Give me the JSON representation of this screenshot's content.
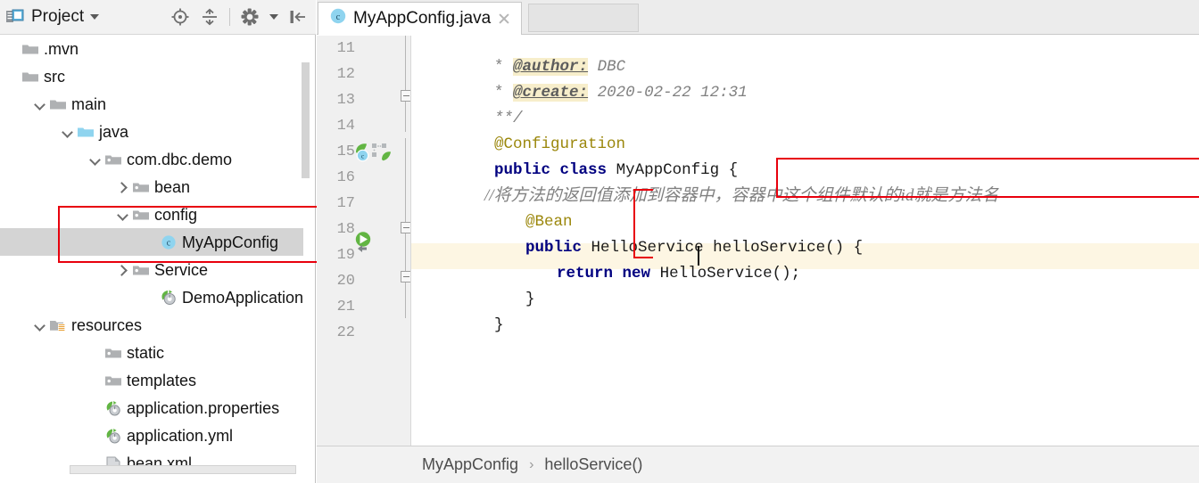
{
  "project_panel": {
    "title": "Project",
    "toolbar_icons": [
      "locate-target-icon",
      "collapse-all-icon",
      "settings-gear-icon",
      "hide-panel-icon"
    ],
    "tree": [
      {
        "label": ".mvn",
        "icon": "folder-grey-icon",
        "indent": 0,
        "arrow": "none",
        "selected": false
      },
      {
        "label": "src",
        "icon": "folder-grey-icon",
        "indent": 0,
        "arrow": "none",
        "selected": false
      },
      {
        "label": "main",
        "icon": "folder-grey-icon",
        "indent": 1,
        "arrow": "down",
        "selected": false
      },
      {
        "label": "java",
        "icon": "folder-blue-icon",
        "indent": 2,
        "arrow": "down",
        "selected": false
      },
      {
        "label": "com.dbc.demo",
        "icon": "package-icon",
        "indent": 3,
        "arrow": "down",
        "selected": false
      },
      {
        "label": "bean",
        "icon": "package-icon",
        "indent": 4,
        "arrow": "right",
        "selected": false
      },
      {
        "label": "config",
        "icon": "package-icon",
        "indent": 4,
        "arrow": "down",
        "selected": false
      },
      {
        "label": "MyAppConfig",
        "icon": "java-class-icon",
        "indent": 5,
        "arrow": "none",
        "selected": true
      },
      {
        "label": "Service",
        "icon": "package-icon",
        "indent": 4,
        "arrow": "right",
        "selected": false
      },
      {
        "label": "DemoApplication",
        "icon": "spring-boot-class-icon",
        "indent": 5,
        "arrow": "none",
        "selected": false
      },
      {
        "label": "resources",
        "icon": "resources-folder-icon",
        "indent": 1,
        "arrow": "down",
        "selected": false
      },
      {
        "label": "static",
        "icon": "package-icon",
        "indent": 3,
        "arrow": "none",
        "selected": false
      },
      {
        "label": "templates",
        "icon": "package-icon",
        "indent": 3,
        "arrow": "none",
        "selected": false
      },
      {
        "label": "application.properties",
        "icon": "spring-file-icon",
        "indent": 3,
        "arrow": "none",
        "selected": false
      },
      {
        "label": "application.yml",
        "icon": "spring-file-icon",
        "indent": 3,
        "arrow": "none",
        "selected": false
      },
      {
        "label": "bean.xml",
        "icon": "xml-file-icon",
        "indent": 3,
        "arrow": "none",
        "selected": false
      }
    ]
  },
  "editor": {
    "tab": {
      "label": "MyAppConfig.java",
      "icon": "java-class-icon",
      "close": "close-icon"
    },
    "first_line_number": 11,
    "lines": [
      {
        "num": 11,
        "gutter_icon": "none"
      },
      {
        "num": 12,
        "gutter_icon": "none"
      },
      {
        "num": 13,
        "gutter_icon": "none"
      },
      {
        "num": 14,
        "gutter_icon": "none"
      },
      {
        "num": 15,
        "gutter_icon": "spring-bean-class-icon"
      },
      {
        "num": 16,
        "gutter_icon": "none"
      },
      {
        "num": 17,
        "gutter_icon": "spring-bean-navigate-icon"
      },
      {
        "num": 18,
        "gutter_icon": "none"
      },
      {
        "num": 19,
        "gutter_icon": "none"
      },
      {
        "num": 20,
        "gutter_icon": "none"
      },
      {
        "num": 21,
        "gutter_icon": "none"
      },
      {
        "num": 22,
        "gutter_icon": "none"
      }
    ],
    "code": {
      "l11_star": "*",
      "l11_tag": "@author:",
      "l11_val": "DBC",
      "l12_star": "*",
      "l12_tag": "@create:",
      "l12_val": "2020-02-22 12:31",
      "l13": "**/",
      "l14": "@Configuration",
      "l15_kw": "public class",
      "l15_name": "MyAppConfig",
      "l15_brace": "{",
      "l16_comment": "//将方法的返回值添加到容器中，容器中这个组件默认的id就是方法名",
      "l17": "@Bean",
      "l18_kw": "public",
      "l18_rest": "HelloService helloService() {",
      "l19_kw": "return new",
      "l19_rest": "HelloService();",
      "l20": "}",
      "l21": "}"
    },
    "breadcrumb": {
      "class": "MyAppConfig",
      "separator": "›",
      "method": "helloService()"
    }
  },
  "annotations": {
    "color": "#e8000d",
    "boxes": [
      "config-package-highlight",
      "chinese-comment-highlight",
      "bean-method-marker"
    ]
  },
  "colors": {
    "keyword": "#000080",
    "annotation": "#9b870c",
    "comment": "#808080",
    "selection": "#d4d4d4",
    "current_line": "#fdf6e3",
    "javadoc_tag_bg": "#f7eecb"
  }
}
